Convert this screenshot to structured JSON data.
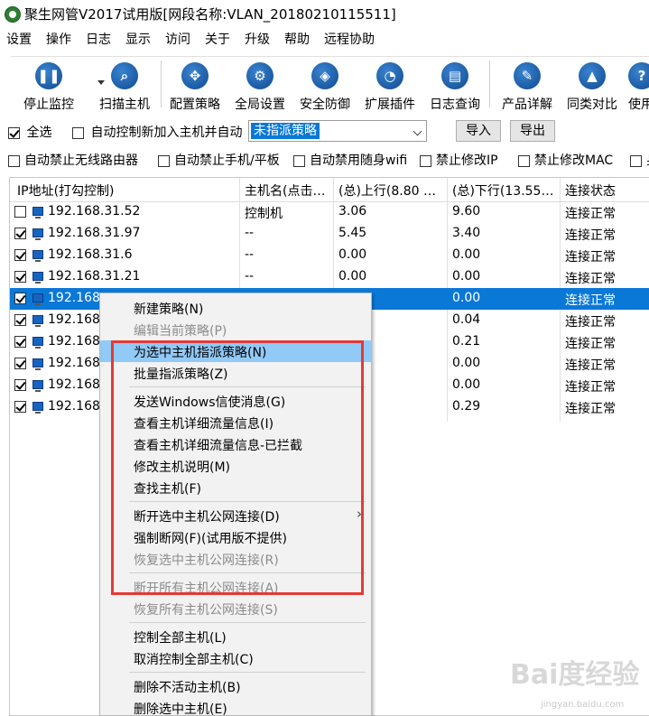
{
  "window": {
    "title": "聚生网管V2017试用版[网段名称:VLAN_20180210115511]"
  },
  "menubar": [
    "设置",
    "操作",
    "日志",
    "显示",
    "访问",
    "关于",
    "升级",
    "帮助",
    "远程协助"
  ],
  "toolbar": {
    "buttons": [
      {
        "label": "停止监控",
        "icon": "pause-icon"
      },
      {
        "label": "扫描主机",
        "icon": "scan-icon"
      },
      {
        "label": "配置策略",
        "icon": "config-icon"
      },
      {
        "label": "全局设置",
        "icon": "gear-icon"
      },
      {
        "label": "安全防御",
        "icon": "shield-icon"
      },
      {
        "label": "扩展插件",
        "icon": "plugin-icon"
      },
      {
        "label": "日志查询",
        "icon": "log-icon"
      },
      {
        "label": "产品详解",
        "icon": "product-icon"
      },
      {
        "label": "同类对比",
        "icon": "compare-icon"
      },
      {
        "label": "使用",
        "icon": "usage-icon"
      }
    ]
  },
  "options": {
    "select_all": "全选",
    "auto_control": "自动控制新加入主机并自动",
    "policy_select": "未指派策略",
    "import": "导入",
    "export": "导出",
    "row2": [
      "自动禁止无线路由器",
      "自动禁止手机/平板",
      "自动禁用随身wifi",
      "禁止修改IP",
      "禁止修改MAC",
      "身"
    ]
  },
  "table": {
    "headers": [
      "IP地址(打勾控制)",
      "主机名(点击…",
      "(总)上行(8.80 …",
      "(总)下行(13.55…",
      "连接状态"
    ],
    "rows": [
      {
        "ip": "192.168.31.52",
        "host": "控制机",
        "up": "3.06",
        "down": "9.60",
        "status": "连接正常",
        "checked": false
      },
      {
        "ip": "192.168.31.97",
        "host": "--",
        "up": "5.45",
        "down": "3.40",
        "status": "连接正常",
        "checked": true
      },
      {
        "ip": "192.168.31.6",
        "host": "--",
        "up": "0.00",
        "down": "0.00",
        "status": "连接正常",
        "checked": true
      },
      {
        "ip": "192.168.31.21",
        "host": "--",
        "up": "0.00",
        "down": "0.00",
        "status": "连接正常",
        "checked": true
      },
      {
        "ip": "192.168",
        "host": "",
        "up": "",
        "down": "0.00",
        "status": "连接正常",
        "checked": true
      },
      {
        "ip": "192.168",
        "host": "",
        "up": "",
        "down": "0.04",
        "status": "连接正常",
        "checked": true
      },
      {
        "ip": "192.168",
        "host": "",
        "up": "",
        "down": "0.21",
        "status": "连接正常",
        "checked": true
      },
      {
        "ip": "192.168",
        "host": "",
        "up": "",
        "down": "0.00",
        "status": "连接正常",
        "checked": true
      },
      {
        "ip": "192.168",
        "host": "",
        "up": "",
        "down": "0.00",
        "status": "连接正常",
        "checked": true
      },
      {
        "ip": "192.168",
        "host": "",
        "up": "",
        "down": "0.29",
        "status": "连接正常",
        "checked": true
      }
    ]
  },
  "context_menu": {
    "items": [
      {
        "label": "新建策略(N)"
      },
      {
        "label": "编辑当前策略(P)"
      },
      {
        "label": "为选中主机指派策略(N)"
      },
      {
        "label": "批量指派策略(Z)"
      },
      {
        "label": "发送Windows信使消息(G)"
      },
      {
        "label": "查看主机详细流量信息(I)"
      },
      {
        "label": "查看主机详细流量信息-已拦截"
      },
      {
        "label": "修改主机说明(M)"
      },
      {
        "label": "查找主机(F)"
      },
      {
        "label": "断开选中主机公网连接(D)"
      },
      {
        "label": "强制断网(F)(试用版不提供)"
      },
      {
        "label": "恢复选中主机公网连接(R)"
      },
      {
        "label": "断开所有主机公网连接(A)"
      },
      {
        "label": "恢复所有主机公网连接(S)"
      },
      {
        "label": "控制全部主机(L)"
      },
      {
        "label": "取消控制全部主机(C)"
      },
      {
        "label": "删除不活动主机(B)"
      },
      {
        "label": "删除选中主机(E)"
      }
    ]
  },
  "watermark": {
    "brand": "Bai度经验",
    "url": "jingyan.baidu.com"
  },
  "colors": {
    "selection": "#0a78d7",
    "highlight": "#91c9f7",
    "annotation": "#e53935",
    "icon_blue": "#1565c0"
  }
}
